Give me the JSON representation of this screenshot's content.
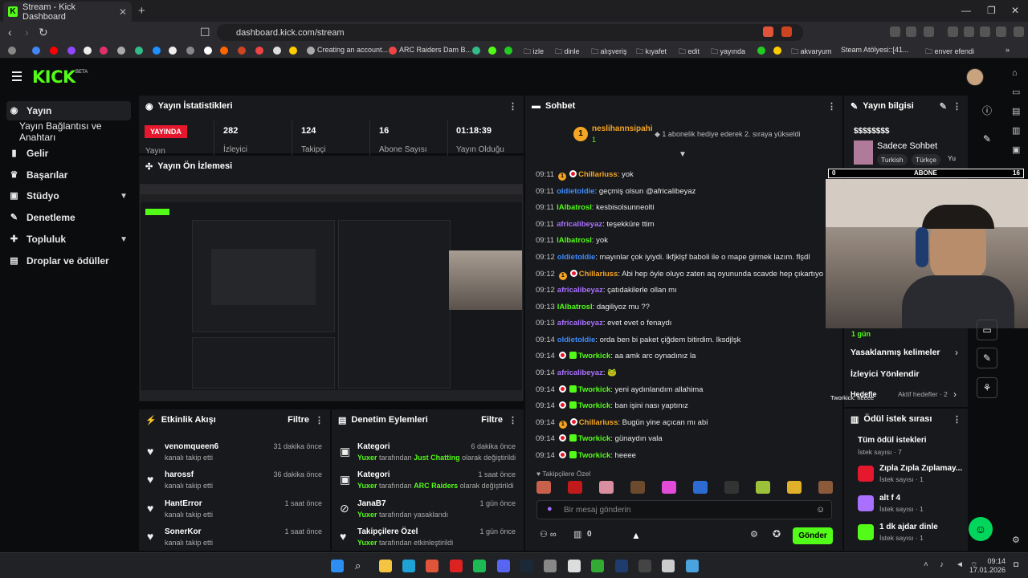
{
  "browser": {
    "tab_title": "Stream - Kick Dashboard",
    "url": "dashboard.kick.com/stream",
    "bookmarks": [
      "Creating an account...",
      "ARC Raiders Dam B...",
      "izle",
      "dinle",
      "alışveriş",
      "kıyafet",
      "edit",
      "yayında",
      "akvaryum",
      "Steam Atölyesi::[41...",
      "enver efendi"
    ]
  },
  "app": {
    "logo": "KICK",
    "beta": "BETA"
  },
  "sidebar": {
    "items": [
      {
        "label": "Yayın",
        "icon": "broadcast-icon"
      },
      {
        "label": "Yayın Bağlantısı ve Anahtarı",
        "icon": ""
      },
      {
        "label": "Gelir",
        "icon": "chart-icon"
      },
      {
        "label": "Başarılar",
        "icon": "trophy-icon"
      },
      {
        "label": "Stüdyo",
        "icon": "studio-icon"
      },
      {
        "label": "Denetleme",
        "icon": "wrench-icon"
      },
      {
        "label": "Topluluk",
        "icon": "community-icon"
      },
      {
        "label": "Droplar ve ödüller",
        "icon": "gift-icon"
      }
    ]
  },
  "stats": {
    "title": "Yayın İstatistikleri",
    "live_badge": "YAYINDA",
    "live_label": "Yayın",
    "items": [
      {
        "value": "282",
        "label": "İzleyici"
      },
      {
        "value": "124",
        "label": "Takipçi"
      },
      {
        "value": "16",
        "label": "Abone Sayısı"
      },
      {
        "value": "01:18:39",
        "label": "Yayın Olduğu"
      }
    ]
  },
  "preview": {
    "title": "Yayın Ön İzlemesi"
  },
  "activity": {
    "title": "Etkinlik Akışı",
    "filter": "Filtre",
    "items": [
      {
        "name": "venomqueen6",
        "sub": "kanalı takip etti",
        "time": "31 dakika önce"
      },
      {
        "name": "harossf",
        "sub": "kanalı takip etti",
        "time": "36 dakika önce"
      },
      {
        "name": "HantError",
        "sub": "kanalı takip etti",
        "time": "1 saat önce"
      },
      {
        "name": "SonerKor",
        "sub": "kanalı takip etti",
        "time": "1 saat önce"
      }
    ]
  },
  "moderation": {
    "title": "Denetim Eylemleri",
    "filter": "Filtre",
    "items": [
      {
        "name": "Kategori",
        "actor": "Yuxer",
        "mid": "tarafından",
        "hl": "Just Chatting",
        "end": "olarak değiştirildi",
        "time": "6 dakika önce"
      },
      {
        "name": "Kategori",
        "actor": "Yuxer",
        "mid": "tarafından",
        "hl": "ARC Raiders",
        "end": "olarak değiştirildi",
        "time": "1 saat önce"
      },
      {
        "name": "JanaB7",
        "actor": "Yuxer",
        "mid": "tarafından yasaklandı",
        "hl": "",
        "end": "",
        "time": "1 gün önce"
      },
      {
        "name": "Takipçilere Özel",
        "actor": "Yuxer",
        "mid": "tarafından etkinleştirildi",
        "hl": "",
        "end": "",
        "time": "1 gün önce"
      }
    ]
  },
  "chat": {
    "title": "Sohbet",
    "pinned_user": "neslihannsipahi",
    "pinned_count": "1",
    "pinned_text": "1 abonelik hediye ederek 2. sıraya yükseldi",
    "messages": [
      {
        "time": "09:11",
        "user": "Chillariuss",
        "text": "yok",
        "color": "#f5a524",
        "badges": "or"
      },
      {
        "time": "09:11",
        "user": "oldietoldie",
        "text": "geçmiş olsun @africalibeyaz",
        "color": "#3d8bff",
        "badges": ""
      },
      {
        "time": "09:11",
        "user": "lAlbatrosl",
        "text": "kesbisolsunneolti",
        "color": "#53fc18",
        "badges": ""
      },
      {
        "time": "09:11",
        "user": "africalibeyaz",
        "text": "teşekküre ttim",
        "color": "#a970ff",
        "badges": ""
      },
      {
        "time": "09:11",
        "user": "lAlbatrosl",
        "text": "yok",
        "color": "#53fc18",
        "badges": ""
      },
      {
        "time": "09:12",
        "user": "oldietoldie",
        "text": "mayınlar çok iyiydi. lkfjklşf baboli ile o mape girmek lazım. flşdl",
        "color": "#3d8bff",
        "badges": ""
      },
      {
        "time": "09:12",
        "user": "Chillariuss",
        "text": "Abi hep öyle oluyo zaten aq oyununda scavde hep çıkartıyo",
        "color": "#f5a524",
        "badges": "or"
      },
      {
        "time": "09:12",
        "user": "africalibeyaz",
        "text": "çatıdakilerle ollan mı",
        "color": "#a970ff",
        "badges": ""
      },
      {
        "time": "09:13",
        "user": "lAlbatrosl",
        "text": "dagiliyoz mu ??",
        "color": "#53fc18",
        "badges": ""
      },
      {
        "time": "09:13",
        "user": "africalibeyaz",
        "text": "evet evet o fenaydı",
        "color": "#a970ff",
        "badges": ""
      },
      {
        "time": "09:14",
        "user": "oldietoldie",
        "text": "orda ben bi paket çiğdem bitirdim. lksdjlşk",
        "color": "#3d8bff",
        "badges": ""
      },
      {
        "time": "09:14",
        "user": "Tworkick",
        "text": "aa amk arc oynadınız la",
        "color": "#53fc18",
        "badges": "rg"
      },
      {
        "time": "09:14",
        "user": "africalibeyaz",
        "text": "🐸",
        "color": "#a970ff",
        "badges": ""
      },
      {
        "time": "09:14",
        "user": "Tworkick",
        "text": "yeni aydınlandım allahima",
        "color": "#53fc18",
        "badges": "rg"
      },
      {
        "time": "09:14",
        "user": "Tworkick",
        "text": "ban işini nası yaptınız",
        "color": "#53fc18",
        "badges": "rg"
      },
      {
        "time": "09:14",
        "user": "Chillariuss",
        "text": "Bugün yine açıcan mı abi",
        "color": "#f5a524",
        "badges": "or"
      },
      {
        "time": "09:14",
        "user": "Tworkick",
        "text": "günaydın vala",
        "color": "#53fc18",
        "badges": "rg"
      },
      {
        "time": "09:14",
        "user": "Tworkick",
        "text": "heeee",
        "color": "#53fc18",
        "badges": "rg"
      }
    ],
    "followers_only": "Takipçilere Özel",
    "input_placeholder": "Bir mesaj gönderin",
    "count": "0",
    "send": "Gönder"
  },
  "info": {
    "title": "Yayın bilgisi",
    "stream_title": "$$$$$$$$",
    "category": "Sadece Sohbet",
    "tags": [
      "Turkish",
      "Türkçe",
      "Yu"
    ],
    "goal_start": "0",
    "goal_label": "ABONE",
    "goal_end": "16",
    "day_label": "1 gün",
    "banned_words": "Yasaklanmış kelimeler",
    "viewer_levels": "İzleyici Yönlendir",
    "goals": "Hedefle",
    "goals_sub": "Aktif hedefler · 2",
    "overlay_user": "Tworkick: heeee"
  },
  "rewards": {
    "title": "Ödül istek sırası",
    "all": "Tüm ödül istekleri",
    "all_sub": "İstek sayısı · 7",
    "items": [
      {
        "name": "Zıpla Zıpla Zıplamay...",
        "sub": "İstek sayısı · 1",
        "color": "#e5182e"
      },
      {
        "name": "alt f 4",
        "sub": "İstek sayısı · 1",
        "color": "#a970ff"
      },
      {
        "name": "1 dk ajdar dinle",
        "sub": "İstek sayısı · 1",
        "color": "#53fc18"
      }
    ]
  },
  "taskbar": {
    "time": "09:14",
    "date": "17.01.2026"
  }
}
